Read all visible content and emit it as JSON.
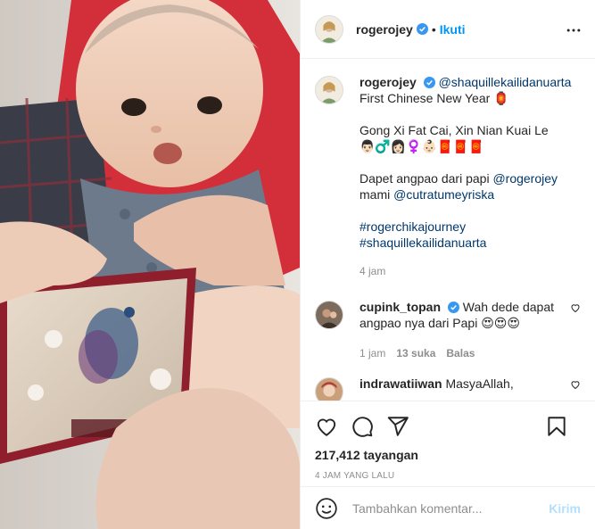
{
  "post": {
    "username": "rogerojey",
    "follow_label": "Ikuti",
    "dot": "•",
    "caption": {
      "mention": "@shaquillekailidanuarta",
      "line1": "First Chinese New Year 🏮",
      "line2": "Gong Xi Fat Cai, Xin Nian Kuai Le",
      "line3": "👨🏻‍♂️👩🏻‍♀️👶🏻🧧🧧🧧",
      "line4_prefix": "Dapet angpao dari papi",
      "line4_mention": "@rogerojey",
      "line5_prefix": "mami",
      "line5_mention": "@cutratumeyriska",
      "hashtag1": "#rogerchikajourney",
      "hashtag2": "#shaquillekailidanuarta",
      "time": "4 jam"
    }
  },
  "comments": [
    {
      "username": "cupink_topan",
      "text": "Wah dede dapat angpao nya dari Papi 😍😍😍",
      "time": "1 jam",
      "likes": "13 suka",
      "reply_label": "Balas"
    },
    {
      "username": "indrawatiiwan",
      "text": "MasyaAllah,"
    }
  ],
  "stats": {
    "views": "217,412 tayangan",
    "time_ago": "4 JAM YANG LALU"
  },
  "comment_box": {
    "placeholder": "Tambahkan komentar...",
    "post_label": "Kirim"
  },
  "colors": {
    "accent": "#0095f6",
    "verified": "#3897f0",
    "post_disabled": "#b2dffc"
  },
  "icons": [
    "more-icon",
    "heart-icon",
    "comment-icon",
    "share-icon",
    "save-icon",
    "emoji-icon",
    "verified-icon"
  ]
}
